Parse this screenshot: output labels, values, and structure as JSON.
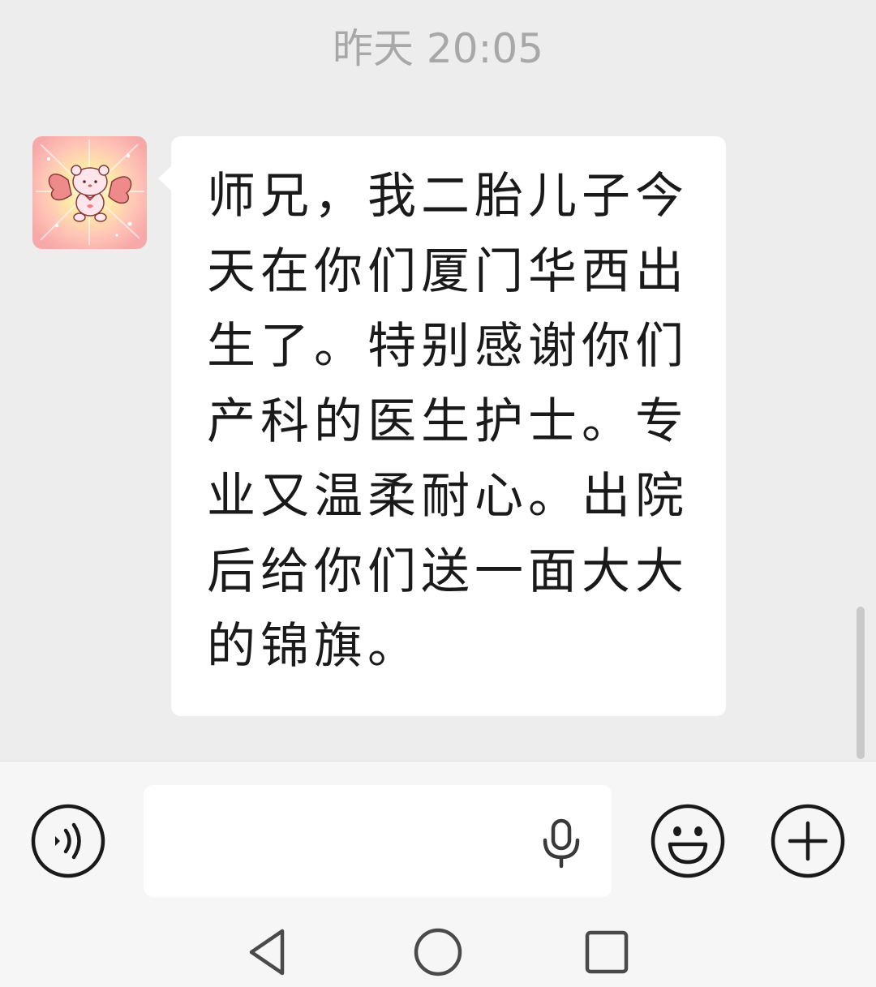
{
  "chat": {
    "timestamp": "昨天 20:05",
    "messages": [
      {
        "sender": "other",
        "avatar_icon": "pink-bear-avatar-icon",
        "text": "师兄，我二胎儿子今天在你们厦门华西出生了。特别感谢你们产科的医生护士。专业又温柔耐心。出院后给你们送一面大大的锦旗。"
      }
    ]
  },
  "input_bar": {
    "voice_icon": "voice-icon",
    "input_value": "",
    "mic_icon": "microphone-icon",
    "emoji_icon": "smiley-face-icon",
    "plus_icon": "plus-icon"
  },
  "nav_bar": {
    "back_icon": "triangle-back-icon",
    "home_icon": "circle-home-icon",
    "recent_icon": "square-recent-apps-icon"
  },
  "colors": {
    "chat_background": "#ededed",
    "bubble_background": "#ffffff",
    "input_bar_background": "#f6f6f6",
    "timestamp_text": "#a8a8a8",
    "message_text": "#1a1a1a",
    "icon_stroke": "#1a1a1a"
  }
}
